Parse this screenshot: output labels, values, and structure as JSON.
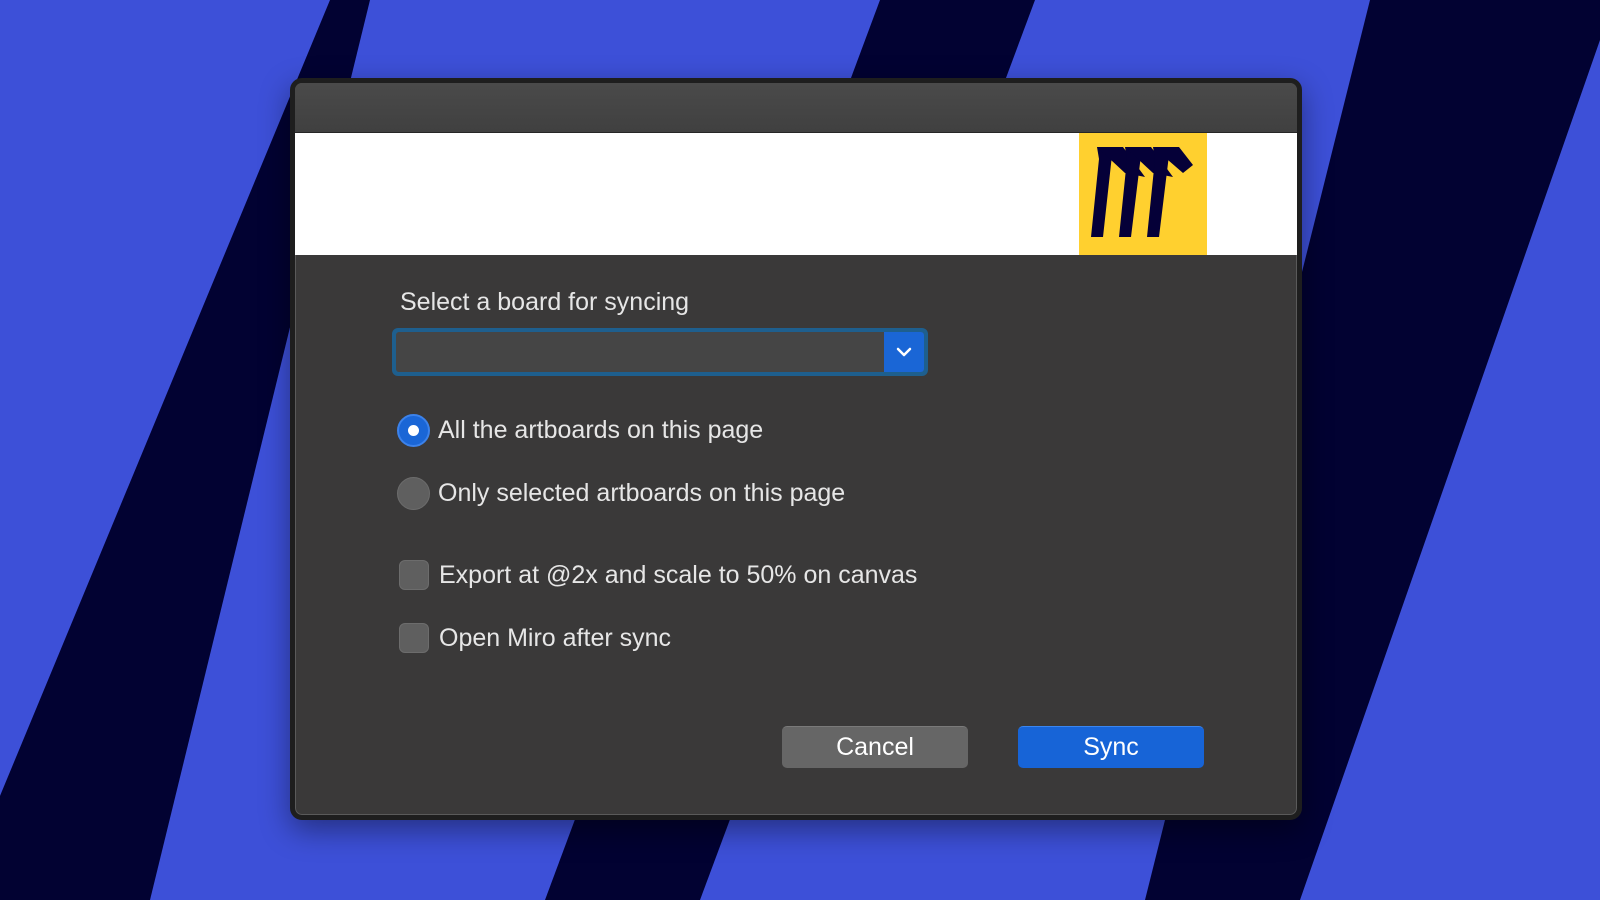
{
  "dialog": {
    "board_select": {
      "label": "Select a board for syncing",
      "value": ""
    },
    "scope_options": [
      {
        "label": "All the artboards on this page",
        "checked": true
      },
      {
        "label": "Only selected artboards on this page",
        "checked": false
      }
    ],
    "checkboxes": [
      {
        "label": "Export at @2x and scale to 50% on canvas",
        "checked": false
      },
      {
        "label": "Open Miro after sync",
        "checked": false
      }
    ],
    "buttons": {
      "cancel": "Cancel",
      "sync": "Sync"
    },
    "logo": {
      "name": "miro-logo",
      "color": "#ffd02f"
    }
  },
  "colors": {
    "background": "#3d50d8",
    "stripes": "#020232",
    "dialog": "#3a3939",
    "accent": "#1a66d6"
  }
}
